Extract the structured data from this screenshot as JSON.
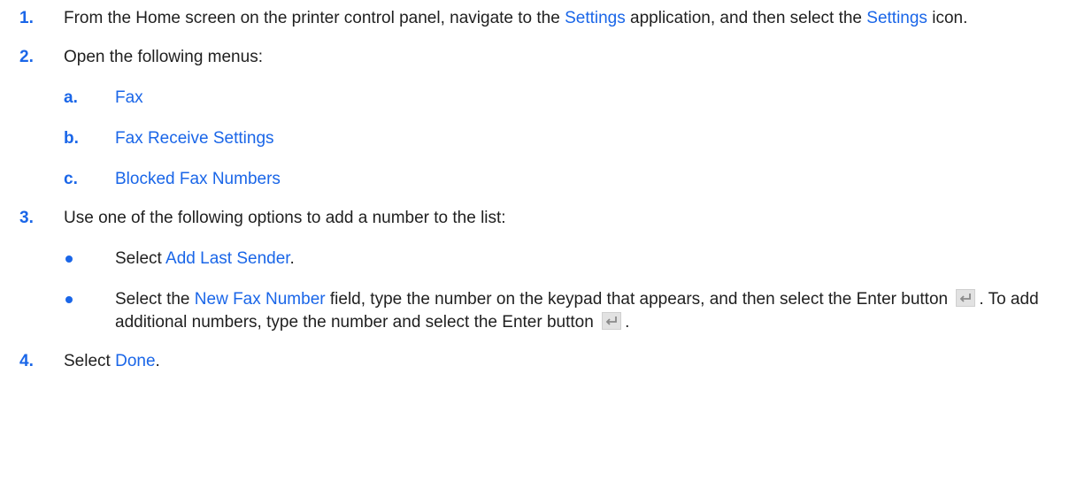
{
  "steps": [
    {
      "number": "1.",
      "text": {
        "a": "From the Home screen on the printer control panel, navigate to the ",
        "link1": "Settings",
        "b": " application, and then select the ",
        "link2": "Settings",
        "c": " icon."
      }
    },
    {
      "number": "2.",
      "text": "Open the following menus:",
      "menus": [
        {
          "letter": "a.",
          "label": "Fax"
        },
        {
          "letter": "b.",
          "label": "Fax Receive Settings"
        },
        {
          "letter": "c.",
          "label": "Blocked Fax Numbers"
        }
      ]
    },
    {
      "number": "3.",
      "text": "Use one of the following options to add a number to the list:",
      "options": [
        {
          "pre": "Select ",
          "link": "Add Last Sender",
          "post": "."
        },
        {
          "pre": "Select the ",
          "link": "New Fax Number",
          "mid": " field, type the number on the keypad that appears, and then select the Enter button ",
          "mid2": ". To add additional numbers, type the number and select the Enter button ",
          "post": "."
        }
      ]
    },
    {
      "number": "4.",
      "text": {
        "pre": "Select ",
        "link": "Done",
        "post": "."
      }
    }
  ],
  "icons": {
    "enter": "enter-icon"
  },
  "colors": {
    "accent": "#1a66e8",
    "text": "#1f1f1f"
  }
}
